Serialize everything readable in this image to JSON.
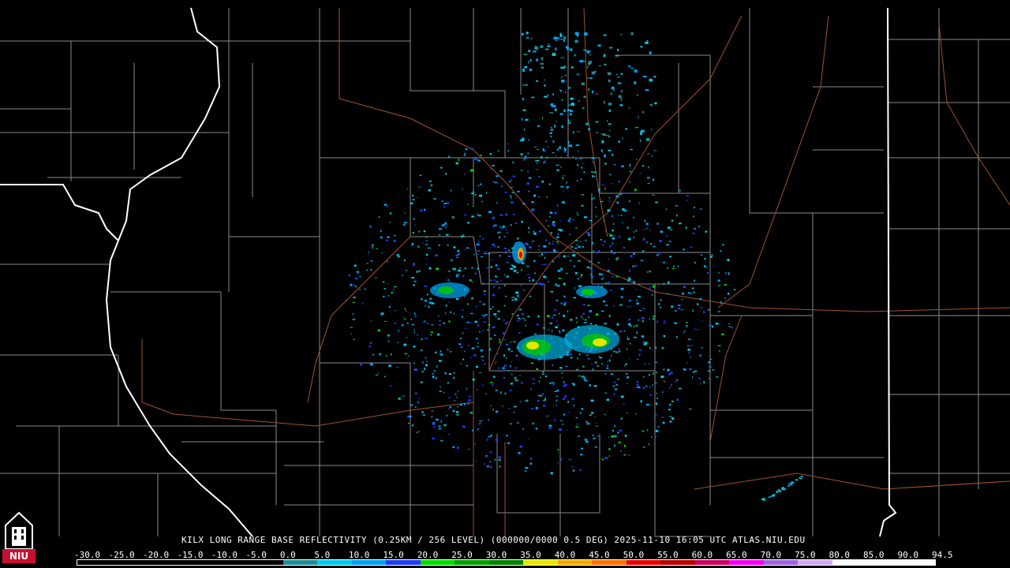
{
  "caption": "KILX LONG RANGE BASE REFLECTIVITY (0.25KM / 256 LEVEL) (000000/0000 0.5 DEG) 2025-11-10 16:05 UTC  ATLAS.NIU.EDU",
  "logo": {
    "text": "NIU",
    "color": "#c8102e",
    "icon": "niu-tower-logo"
  },
  "colorscale": {
    "labels": [
      "-30.0",
      "-25.0",
      "-20.0",
      "-15.0",
      "-10.0",
      "-5.0",
      "0.0",
      "5.0",
      "10.0",
      "15.0",
      "20.0",
      "25.0",
      "30.0",
      "35.0",
      "40.0",
      "45.0",
      "50.0",
      "55.0",
      "60.0",
      "65.0",
      "70.0",
      "75.0",
      "80.0",
      "85.0",
      "90.0",
      "94.5"
    ],
    "colors": [
      "#000000",
      "#000000",
      "#000000",
      "#000000",
      "#000000",
      "#000000",
      "#1e8c96",
      "#00c8e6",
      "#00a0f0",
      "#1e3cf0",
      "#00dc00",
      "#00a000",
      "#008200",
      "#e6e600",
      "#f0aa00",
      "#ff6e00",
      "#e60000",
      "#b40000",
      "#c80064",
      "#f000f0",
      "#a064dc",
      "#d2aaf0",
      "#ffffff",
      "#ffffff",
      "#ffffff"
    ]
  },
  "map": {
    "radar_site": "KILX",
    "background": "#000000",
    "county_line_color": "#9a9a9a",
    "state_line_color": "#ffffff",
    "highway_color": "#a0522d"
  }
}
